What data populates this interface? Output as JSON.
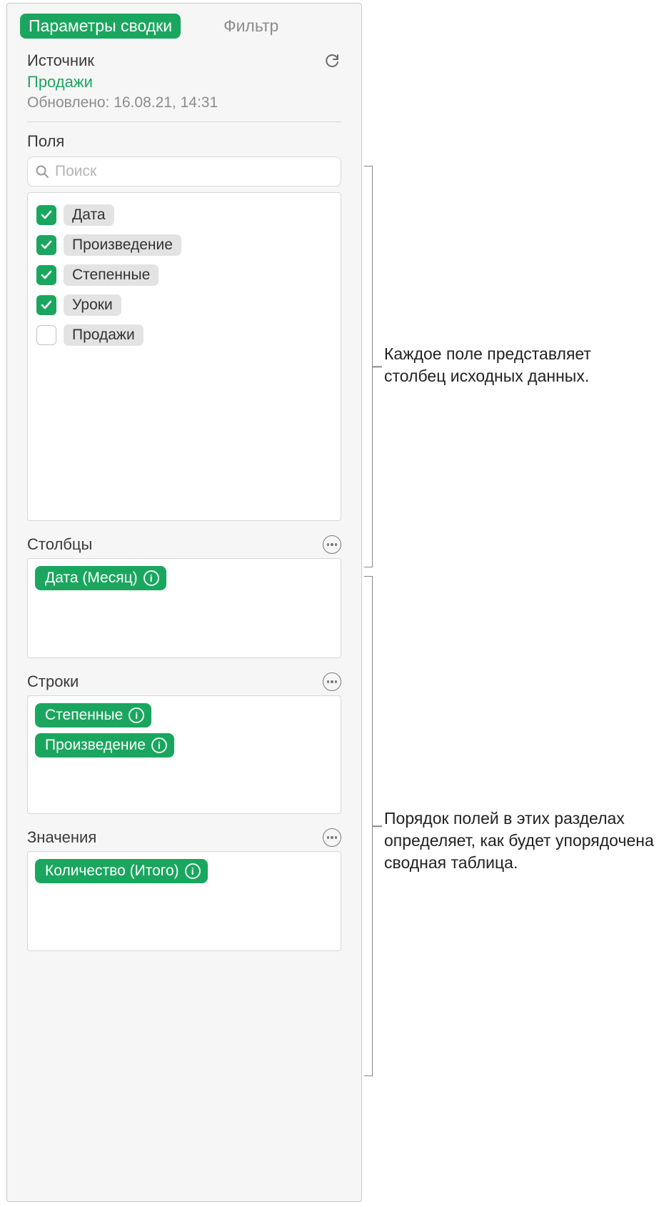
{
  "tabs": {
    "options": "Параметры сводки",
    "filter": "Фильтр"
  },
  "source": {
    "label": "Источник",
    "name": "Продажи",
    "updated": "Обновлено: 16.08.21, 14:31"
  },
  "fields": {
    "label": "Поля",
    "search_placeholder": "Поиск",
    "items": [
      {
        "label": "Дата",
        "checked": true
      },
      {
        "label": "Произведение",
        "checked": true
      },
      {
        "label": "Степенные",
        "checked": true
      },
      {
        "label": "Уроки",
        "checked": true
      },
      {
        "label": "Продажи",
        "checked": false
      }
    ]
  },
  "columns": {
    "label": "Столбцы",
    "items": [
      {
        "label": "Дата (Месяц)"
      }
    ]
  },
  "rows": {
    "label": "Строки",
    "items": [
      {
        "label": "Степенные"
      },
      {
        "label": "Произведение"
      }
    ]
  },
  "values": {
    "label": "Значения",
    "items": [
      {
        "label": "Количество (Итого)"
      }
    ]
  },
  "callouts": {
    "fields": "Каждое поле представляет столбец исходных данных.",
    "sections": "Порядок полей в этих разделах определяет, как будет упорядочена сводная таблица."
  }
}
